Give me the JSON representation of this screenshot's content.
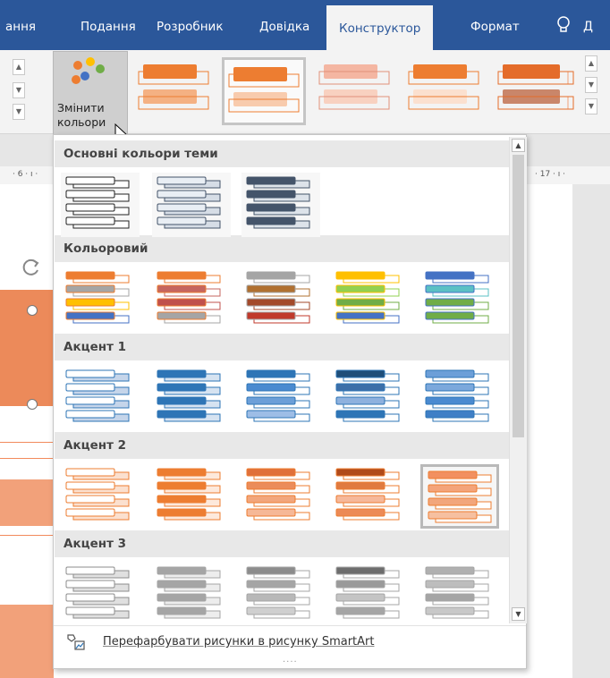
{
  "ribbon": {
    "tabs": [
      {
        "label": "ання"
      },
      {
        "label": "Подання"
      },
      {
        "label": "Розробник"
      },
      {
        "label": "Довідка"
      },
      {
        "label": "Конструктор",
        "active": true
      },
      {
        "label": "Формат"
      }
    ],
    "help_text": "Д",
    "change_colors_label": "Змінити кольори",
    "gallery_styles": [
      "style-1",
      "style-2-selected",
      "style-3",
      "style-4",
      "style-5",
      "style-6"
    ]
  },
  "ruler": {
    "left_label": "· 6 · ı ·",
    "right_label": "· 17 · ı ·"
  },
  "dropdown": {
    "sections": [
      {
        "title": "Основні кольори теми",
        "swatches": [
          {
            "fill": "#ffffff",
            "stroke": "#222222",
            "back": "#ffffff"
          },
          {
            "fill": "#e9eef4",
            "stroke": "#44546a",
            "back": "#d6dde6"
          },
          {
            "fill": "#44546a",
            "stroke": "#44546a",
            "back": "#dde3ea"
          }
        ]
      },
      {
        "title": "Кольоровий",
        "swatches": [
          {
            "rows": [
              "#ed7d31",
              "#a5a5a5",
              "#ffc000",
              "#4472c4"
            ],
            "stroke": "#ed7d31"
          },
          {
            "rows": [
              "#ed7d31",
              "#c5665f",
              "#c0504d",
              "#a5a5a5"
            ],
            "stroke": "#ed7d31"
          },
          {
            "rows": [
              "#a5a5a5",
              "#b07030",
              "#a34a2a",
              "#c0392b"
            ],
            "stroke": "#a5a5a5"
          },
          {
            "rows": [
              "#ffc000",
              "#92d050",
              "#70ad47",
              "#4472c4"
            ],
            "stroke": "#ffc000"
          },
          {
            "rows": [
              "#4472c4",
              "#5bc0c4",
              "#70ad47",
              "#70ad47"
            ],
            "stroke": "#4472c4"
          }
        ]
      },
      {
        "title": "Акцент 1",
        "swatches": [
          {
            "fill": "#ffffff",
            "stroke": "#2e75b6",
            "back": "#c5d5ea"
          },
          {
            "fill": "#2e75b6",
            "stroke": "#2e75b6",
            "back": "#d6e3f1"
          },
          {
            "fill": "#2e75b6",
            "stroke": "#2e75b6",
            "back": "#ffffff",
            "grad": [
              "#2e75b6",
              "#4a8ad0",
              "#6c9fd8",
              "#9dbde6"
            ]
          },
          {
            "fill": "#1f4e79",
            "stroke": "#2e75b6",
            "back": "#ffffff",
            "grad": [
              "#1f4e79",
              "#3c6fa8",
              "#8eb1de",
              "#2e75b6"
            ]
          },
          {
            "fill": "#2e75b6",
            "stroke": "#2e75b6",
            "back": "#ffffff",
            "grad": [
              "#6c9fd8",
              "#7ba8dc",
              "#4a8ad0",
              "#3f7fc6"
            ]
          }
        ]
      },
      {
        "title": "Акцент 2",
        "swatches": [
          {
            "fill": "#ffffff",
            "stroke": "#ed7d31",
            "back": "#fbe0cf"
          },
          {
            "fill": "#ed7d31",
            "stroke": "#ed7d31",
            "back": "#fde9dc"
          },
          {
            "fill": "#ed7d31",
            "stroke": "#ed7d31",
            "back": "#ffffff",
            "grad": [
              "#e0703a",
              "#eb8c5a",
              "#f2a67c",
              "#f6b897"
            ]
          },
          {
            "fill": "#b04a1a",
            "stroke": "#ed7d31",
            "back": "#ffffff",
            "grad": [
              "#b04a1a",
              "#e07a40",
              "#f6b89a",
              "#ec8a56"
            ]
          },
          {
            "fill": "#ed7d31",
            "stroke": "#ed7d31",
            "back": "#ffffff",
            "grad": [
              "#f29060",
              "#f4a47a",
              "#f2a67c",
              "#f6c0a0"
            ],
            "selected": true
          }
        ]
      },
      {
        "title": "Акцент 3",
        "swatches": [
          {
            "fill": "#ffffff",
            "stroke": "#8c8c8c",
            "back": "#e0e0e0"
          },
          {
            "fill": "#a5a5a5",
            "stroke": "#a5a5a5",
            "back": "#ededed"
          },
          {
            "fill": "#a5a5a5",
            "stroke": "#a5a5a5",
            "back": "#ffffff",
            "grad": [
              "#8c8c8c",
              "#a5a5a5",
              "#b8b8b8",
              "#cfcfcf"
            ]
          },
          {
            "fill": "#6d6d6d",
            "stroke": "#a5a5a5",
            "back": "#ffffff",
            "grad": [
              "#6d6d6d",
              "#9a9a9a",
              "#c4c4c4",
              "#a5a5a5"
            ]
          },
          {
            "fill": "#a5a5a5",
            "stroke": "#a5a5a5",
            "back": "#ffffff",
            "grad": [
              "#b0b0b0",
              "#bdbdbd",
              "#a5a5a5",
              "#c8c8c8"
            ]
          }
        ]
      }
    ],
    "footer_label": "Перефарбувати рисунки в рисунку SmartArt",
    "grip": "····"
  },
  "colors": {
    "ribbon_blue": "#2b579a",
    "accent_orange": "#ed7d31"
  }
}
